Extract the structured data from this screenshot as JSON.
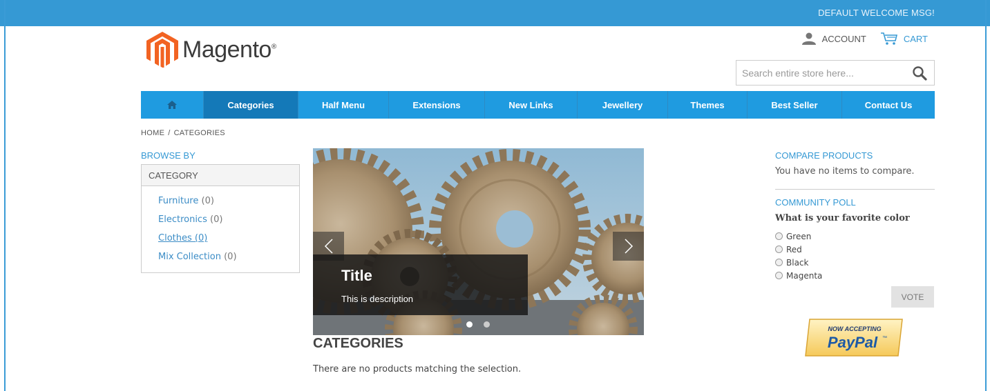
{
  "header": {
    "welcome": "DEFAULT WELCOME MSG!",
    "logo_text": "Magento",
    "logo_mark": "®",
    "account_label": "ACCOUNT",
    "cart_label": "CART",
    "search_placeholder": "Search entire store here..."
  },
  "nav": {
    "home_icon": "home-icon",
    "items": [
      {
        "label": "Categories",
        "active": true
      },
      {
        "label": "Half Menu"
      },
      {
        "label": "Extensions"
      },
      {
        "label": "New Links"
      },
      {
        "label": "Jewellery"
      },
      {
        "label": "Themes"
      },
      {
        "label": "Best Seller"
      },
      {
        "label": "Contact Us"
      }
    ]
  },
  "breadcrumb": {
    "home": "HOME",
    "separator": "/",
    "current": "CATEGORIES"
  },
  "sidebar": {
    "browse_title": "BROWSE BY",
    "category_header": "CATEGORY",
    "categories": [
      {
        "name": "Furniture",
        "count": "(0)"
      },
      {
        "name": "Electronics",
        "count": "(0)"
      },
      {
        "name": "Clothes (0)",
        "count": ""
      },
      {
        "name": "Mix Collection",
        "count": "(0)"
      }
    ]
  },
  "slider": {
    "title": "Title",
    "description": "This is description",
    "slide_count": 2,
    "active_slide": 1
  },
  "main": {
    "title": "CATEGORIES",
    "empty_message": "There are no products matching the selection."
  },
  "compare": {
    "title": "COMPARE PRODUCTS",
    "text": "You have no items to compare."
  },
  "poll": {
    "title": "COMMUNITY POLL",
    "question": "What is your favorite color",
    "options": [
      "Green",
      "Red",
      "Black",
      "Magenta"
    ],
    "vote_label": "VOTE"
  },
  "paypal": {
    "line1": "NOW ACCEPTING",
    "line2": "PayPal",
    "tm": "™"
  },
  "colors": {
    "accent": "#3599d4",
    "nav": "#1f9be0",
    "nav_active": "#1479b8",
    "logo_orange": "#f26322"
  }
}
